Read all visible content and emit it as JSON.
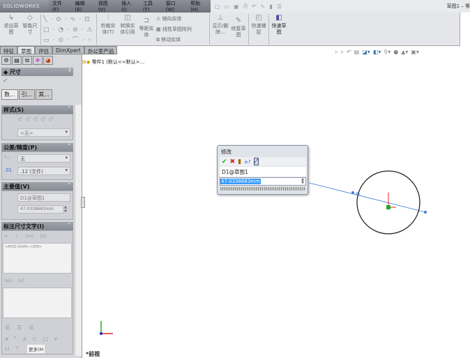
{
  "app": {
    "logo": "SOLIDWORKS",
    "window_title": "草图1 – 零"
  },
  "menu": [
    "文件(F)",
    "编辑(E)",
    "视图(V)",
    "插入(I)",
    "工具(T)",
    "窗口(W)",
    "帮助(H)"
  ],
  "ribbon": {
    "exit_sketch": "退出草图",
    "smart_dim": "智能尺寸",
    "trim": "剪裁实体(T)",
    "convert": "转换实体引用",
    "offset": "等距实体",
    "mirror": "镜向实体",
    "linear_pattern": "线性草图阵列",
    "move": "移动实体",
    "show_delete": "显示/删除...",
    "repair": "修复草图",
    "quick_snap": "快速捕捉",
    "rapid_sketch": "快速草图"
  },
  "tabs": [
    "特征",
    "草图",
    "评估",
    "DimXpert",
    "办公室产品"
  ],
  "panel": {
    "title": "尺寸",
    "subtabs": [
      "数...",
      "引...",
      "其..."
    ],
    "style": {
      "header": "样式(S)",
      "value": "<无>"
    },
    "tolerance": {
      "header": "公差/精度(P)",
      "tol": "无",
      "precision": ".12 (文件)"
    },
    "primary": {
      "header": "主要值(V)",
      "name": "D1@草图1",
      "value": "47.0338683mm"
    },
    "dimtext": {
      "header": "标注尺寸文字(I)",
      "text": "<MOD-DIAM><DIM>",
      "more": "更多(M"
    }
  },
  "tree": "零件1 (默认<<默认>...",
  "dialog": {
    "title": "修改",
    "name": "D1@草图1",
    "value": "47.0338683mm"
  },
  "view_label": "*前视"
}
